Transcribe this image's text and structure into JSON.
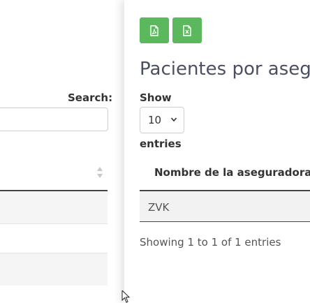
{
  "left_table": {
    "search_label": "Search:",
    "search_value": ""
  },
  "right_panel": {
    "export_buttons": [
      {
        "icon": "pdf-icon"
      },
      {
        "icon": "excel-icon"
      }
    ],
    "title": "Pacientes por asegura",
    "show_label": "Show",
    "entries_value": "10",
    "entries_label": "entries",
    "column_header": "Nombre de la aseguradora",
    "rows": [
      {
        "insurer": "ZVK"
      }
    ],
    "info": "Showing 1 to 1 of 1 entries"
  },
  "colors": {
    "button_green": "#5cb85c",
    "title_color": "#4a5060",
    "row_bg": "#f2f2f2"
  }
}
